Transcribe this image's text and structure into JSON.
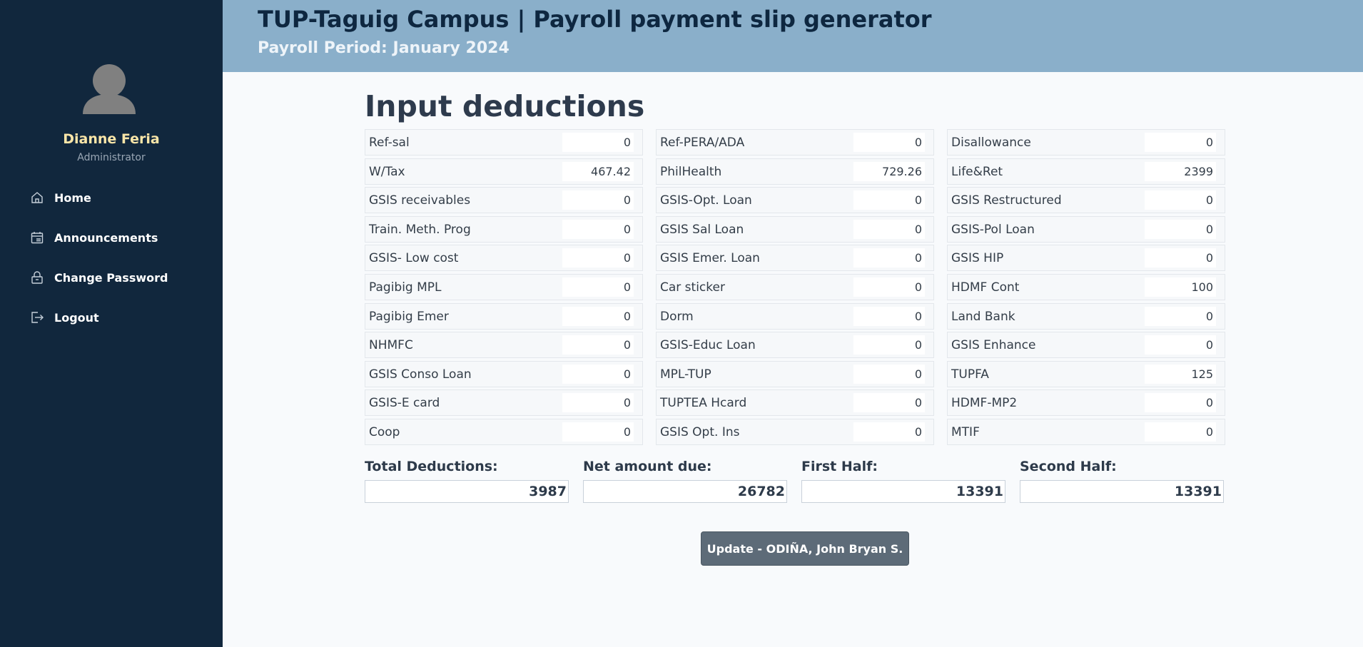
{
  "sidebar": {
    "user_name": "Dianne Feria",
    "user_role": "Administrator",
    "nav": [
      {
        "label": "Home",
        "icon": "home-icon"
      },
      {
        "label": "Announcements",
        "icon": "calendar-icon"
      },
      {
        "label": "Change Password",
        "icon": "lock-icon"
      },
      {
        "label": "Logout",
        "icon": "logout-icon"
      }
    ]
  },
  "header": {
    "title": "TUP-Taguig Campus | Payroll payment slip generator",
    "subtitle": "Payroll Period: January 2024"
  },
  "main": {
    "title": "Input deductions",
    "deductions": [
      [
        {
          "label": "Ref-sal",
          "value": "0"
        },
        {
          "label": "W/Tax",
          "value": "467.42"
        },
        {
          "label": "GSIS receivables",
          "value": "0"
        },
        {
          "label": "Train. Meth. Prog",
          "value": "0"
        },
        {
          "label": "GSIS- Low cost",
          "value": "0"
        },
        {
          "label": "Pagibig MPL",
          "value": "0"
        },
        {
          "label": "Pagibig Emer",
          "value": "0"
        },
        {
          "label": "NHMFC",
          "value": "0"
        },
        {
          "label": "GSIS Conso Loan",
          "value": "0"
        },
        {
          "label": "GSIS-E card",
          "value": "0"
        },
        {
          "label": "Coop",
          "value": "0"
        }
      ],
      [
        {
          "label": "Ref-PERA/ADA",
          "value": "0"
        },
        {
          "label": "PhilHealth",
          "value": "729.26"
        },
        {
          "label": "GSIS-Opt. Loan",
          "value": "0"
        },
        {
          "label": "GSIS Sal Loan",
          "value": "0"
        },
        {
          "label": "GSIS Emer. Loan",
          "value": "0"
        },
        {
          "label": "Car sticker",
          "value": "0"
        },
        {
          "label": "Dorm",
          "value": "0"
        },
        {
          "label": "GSIS-Educ Loan",
          "value": "0"
        },
        {
          "label": "MPL-TUP",
          "value": "0"
        },
        {
          "label": "TUPTEA Hcard",
          "value": "0"
        },
        {
          "label": "GSIS Opt. Ins",
          "value": "0"
        }
      ],
      [
        {
          "label": "Disallowance",
          "value": "0"
        },
        {
          "label": "Life&Ret",
          "value": "2399"
        },
        {
          "label": "GSIS Restructured",
          "value": "0"
        },
        {
          "label": "GSIS-Pol Loan",
          "value": "0"
        },
        {
          "label": "GSIS HIP",
          "value": "0"
        },
        {
          "label": "HDMF Cont",
          "value": "100"
        },
        {
          "label": "Land Bank",
          "value": "0"
        },
        {
          "label": "GSIS Enhance",
          "value": "0"
        },
        {
          "label": "TUPFA",
          "value": "125"
        },
        {
          "label": "HDMF-MP2",
          "value": "0"
        },
        {
          "label": "MTIF",
          "value": "0"
        }
      ]
    ],
    "totals": [
      {
        "label": "Total Deductions:",
        "value": "3987"
      },
      {
        "label": "Net amount due:",
        "value": "26782"
      },
      {
        "label": "First Half:",
        "value": "13391"
      },
      {
        "label": "Second Half:",
        "value": "13391"
      }
    ],
    "update_button": "Update - ODIÑA, John Bryan S."
  }
}
